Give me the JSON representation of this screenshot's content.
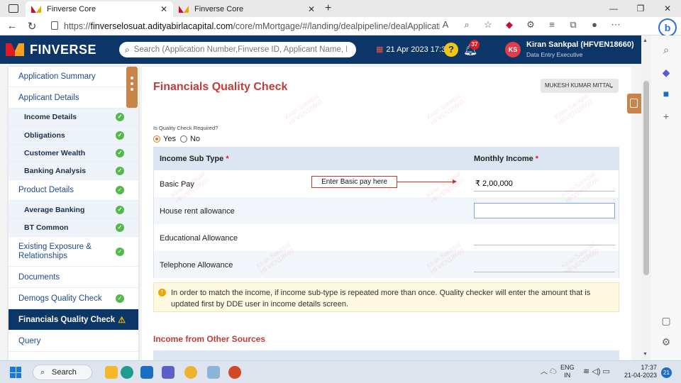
{
  "browser": {
    "tabs": [
      {
        "title": "Finverse Core"
      },
      {
        "title": "Finverse Core"
      }
    ],
    "url_prefix": "https://",
    "url_host": "finverselosuat.adityabirlacapital.com",
    "url_path": "/core/mMortgage/#/landing/dealpipeline/dealApplication/financi..."
  },
  "header": {
    "brand": "FINVERSE",
    "search_placeholder": "Search (Application Number,Finverse ID, Applicant Name, PAN Number)",
    "datetime": "21 Apr 2023 17:37",
    "notifications": "37",
    "avatar_initials": "KS",
    "user_name": "Kiran Sankpal (HFVEN18660)",
    "user_role": "Data Entry Executive"
  },
  "sidebar": {
    "items": [
      {
        "label": "Application Summary"
      },
      {
        "label": "Applicant Details"
      },
      {
        "label": "Income Details"
      },
      {
        "label": "Obligations"
      },
      {
        "label": "Customer Wealth"
      },
      {
        "label": "Banking Analysis"
      },
      {
        "label": "Product Details"
      },
      {
        "label": "Average Banking"
      },
      {
        "label": "BT Common"
      },
      {
        "label": "Existing Exposure & Relationships"
      },
      {
        "label": "Documents"
      },
      {
        "label": "Demogs Quality Check"
      },
      {
        "label": "Financials Quality Check"
      },
      {
        "label": "Query"
      }
    ]
  },
  "main": {
    "title": "Financials Quality Check",
    "user_dropdown": "MUKESH KUMAR MITTAL",
    "quality_check_label": "Is Quality Check Required?",
    "radio_yes": "Yes",
    "radio_no": "No",
    "table": {
      "col_subtype": "Income Sub Type",
      "col_monthly": "Monthly Income",
      "required_mark": "*",
      "rows": [
        {
          "label": "Basic Pay",
          "value": "₹ 2,00,000"
        },
        {
          "label": "House rent allowance",
          "value": ""
        },
        {
          "label": "Educational Allowance",
          "value": ""
        },
        {
          "label": "Telephone Allowance",
          "value": ""
        }
      ]
    },
    "callout": "Enter Basic pay here",
    "note": "In order to match the income, if income sub-type is repeated more than once. Quality checker will enter the amount that is updated first by DDE user in income details screen.",
    "section_other": "Income from Other Sources"
  },
  "taskbar": {
    "search": "Search",
    "lang_1": "ENG",
    "lang_2": "IN",
    "time": "17:37",
    "date": "21-04-2023",
    "notif_count": "21"
  }
}
